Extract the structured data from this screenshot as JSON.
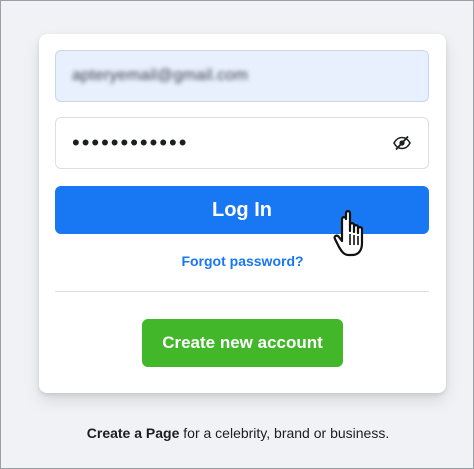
{
  "login_form": {
    "email_value": "apteryemail@gmail.com",
    "password_mask": "••••••••••••",
    "login_label": "Log In",
    "forgot_label": "Forgot password?",
    "create_label": "Create new account"
  },
  "footer": {
    "link_label": "Create a Page",
    "rest_text": " for a celebrity, brand or business."
  },
  "icons": {
    "password_toggle": "eye-slash-icon",
    "cursor": "hand-pointer-cursor"
  },
  "colors": {
    "primary": "#1877f2",
    "success": "#42b72a",
    "background": "#f0f2f5"
  }
}
